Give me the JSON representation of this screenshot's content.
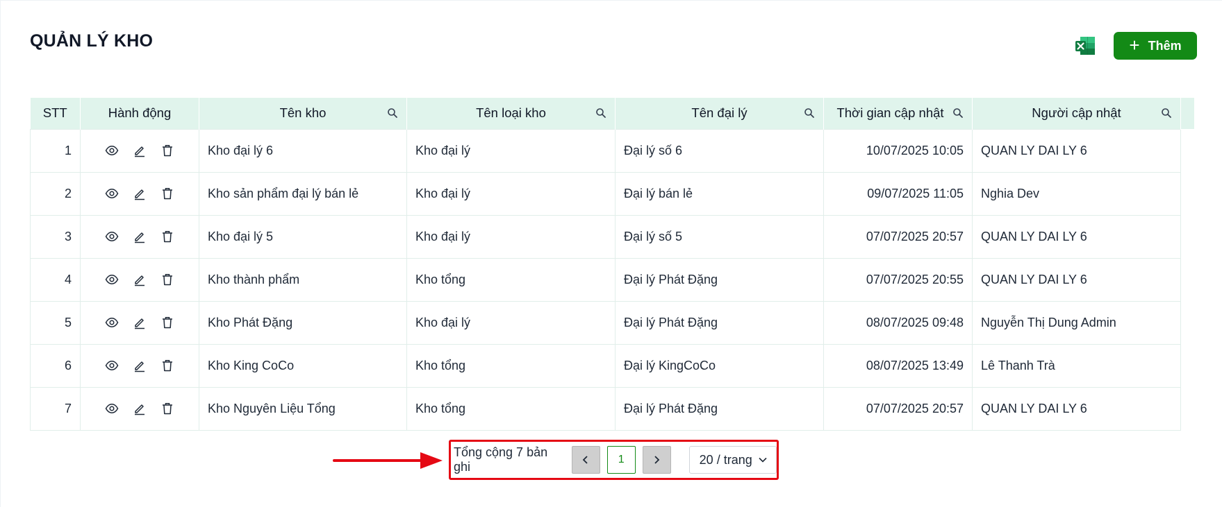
{
  "page": {
    "title": "QUẢN LÝ KHO"
  },
  "toolbar": {
    "add_label": "Thêm",
    "excel_icon": "excel-icon",
    "accent": "#138a16"
  },
  "table": {
    "columns": [
      "STT",
      "Hành động",
      "Tên kho",
      "Tên loại kho",
      "Tên đại lý",
      "Thời gian cập nhật",
      "Người cập nhật"
    ],
    "rows": [
      {
        "stt": "1",
        "ten_kho": "Kho đại lý 6",
        "loai_kho": "Kho đại lý",
        "dai_ly": "Đại lý số 6",
        "thoi_gian": "10/07/2025 10:05",
        "nguoi": "QUAN LY DAI LY 6"
      },
      {
        "stt": "2",
        "ten_kho": "Kho sản phẩm đại lý bán lẻ",
        "loai_kho": "Kho đại lý",
        "dai_ly": "Đại lý bán lẻ",
        "thoi_gian": "09/07/2025 11:05",
        "nguoi": "Nghia Dev"
      },
      {
        "stt": "3",
        "ten_kho": "Kho đại lý 5",
        "loai_kho": "Kho đại lý",
        "dai_ly": "Đại lý số 5",
        "thoi_gian": "07/07/2025 20:57",
        "nguoi": "QUAN LY DAI LY 6"
      },
      {
        "stt": "4",
        "ten_kho": "Kho thành phẩm",
        "loai_kho": "Kho tổng",
        "dai_ly": "Đại lý Phát Đặng",
        "thoi_gian": "07/07/2025 20:55",
        "nguoi": "QUAN LY DAI LY 6"
      },
      {
        "stt": "5",
        "ten_kho": "Kho Phát Đặng",
        "loai_kho": "Kho đại lý",
        "dai_ly": "Đại lý Phát Đặng",
        "thoi_gian": "08/07/2025 09:48",
        "nguoi": "Nguyễn Thị Dung Admin"
      },
      {
        "stt": "6",
        "ten_kho": "Kho King CoCo",
        "loai_kho": "Kho tổng",
        "dai_ly": "Đại lý KingCoCo",
        "thoi_gian": "08/07/2025 13:49",
        "nguoi": "Lê Thanh Trà"
      },
      {
        "stt": "7",
        "ten_kho": "Kho Nguyên Liệu Tổng",
        "loai_kho": "Kho tổng",
        "dai_ly": "Đại lý Phát Đặng",
        "thoi_gian": "07/07/2025 20:57",
        "nguoi": "QUAN LY DAI LY 6"
      }
    ]
  },
  "pagination": {
    "total_text": "Tổng cộng 7 bản ghi",
    "current_page": "1",
    "page_size": "20 / trang"
  },
  "annotation": {
    "highlight_color": "#e50914"
  }
}
